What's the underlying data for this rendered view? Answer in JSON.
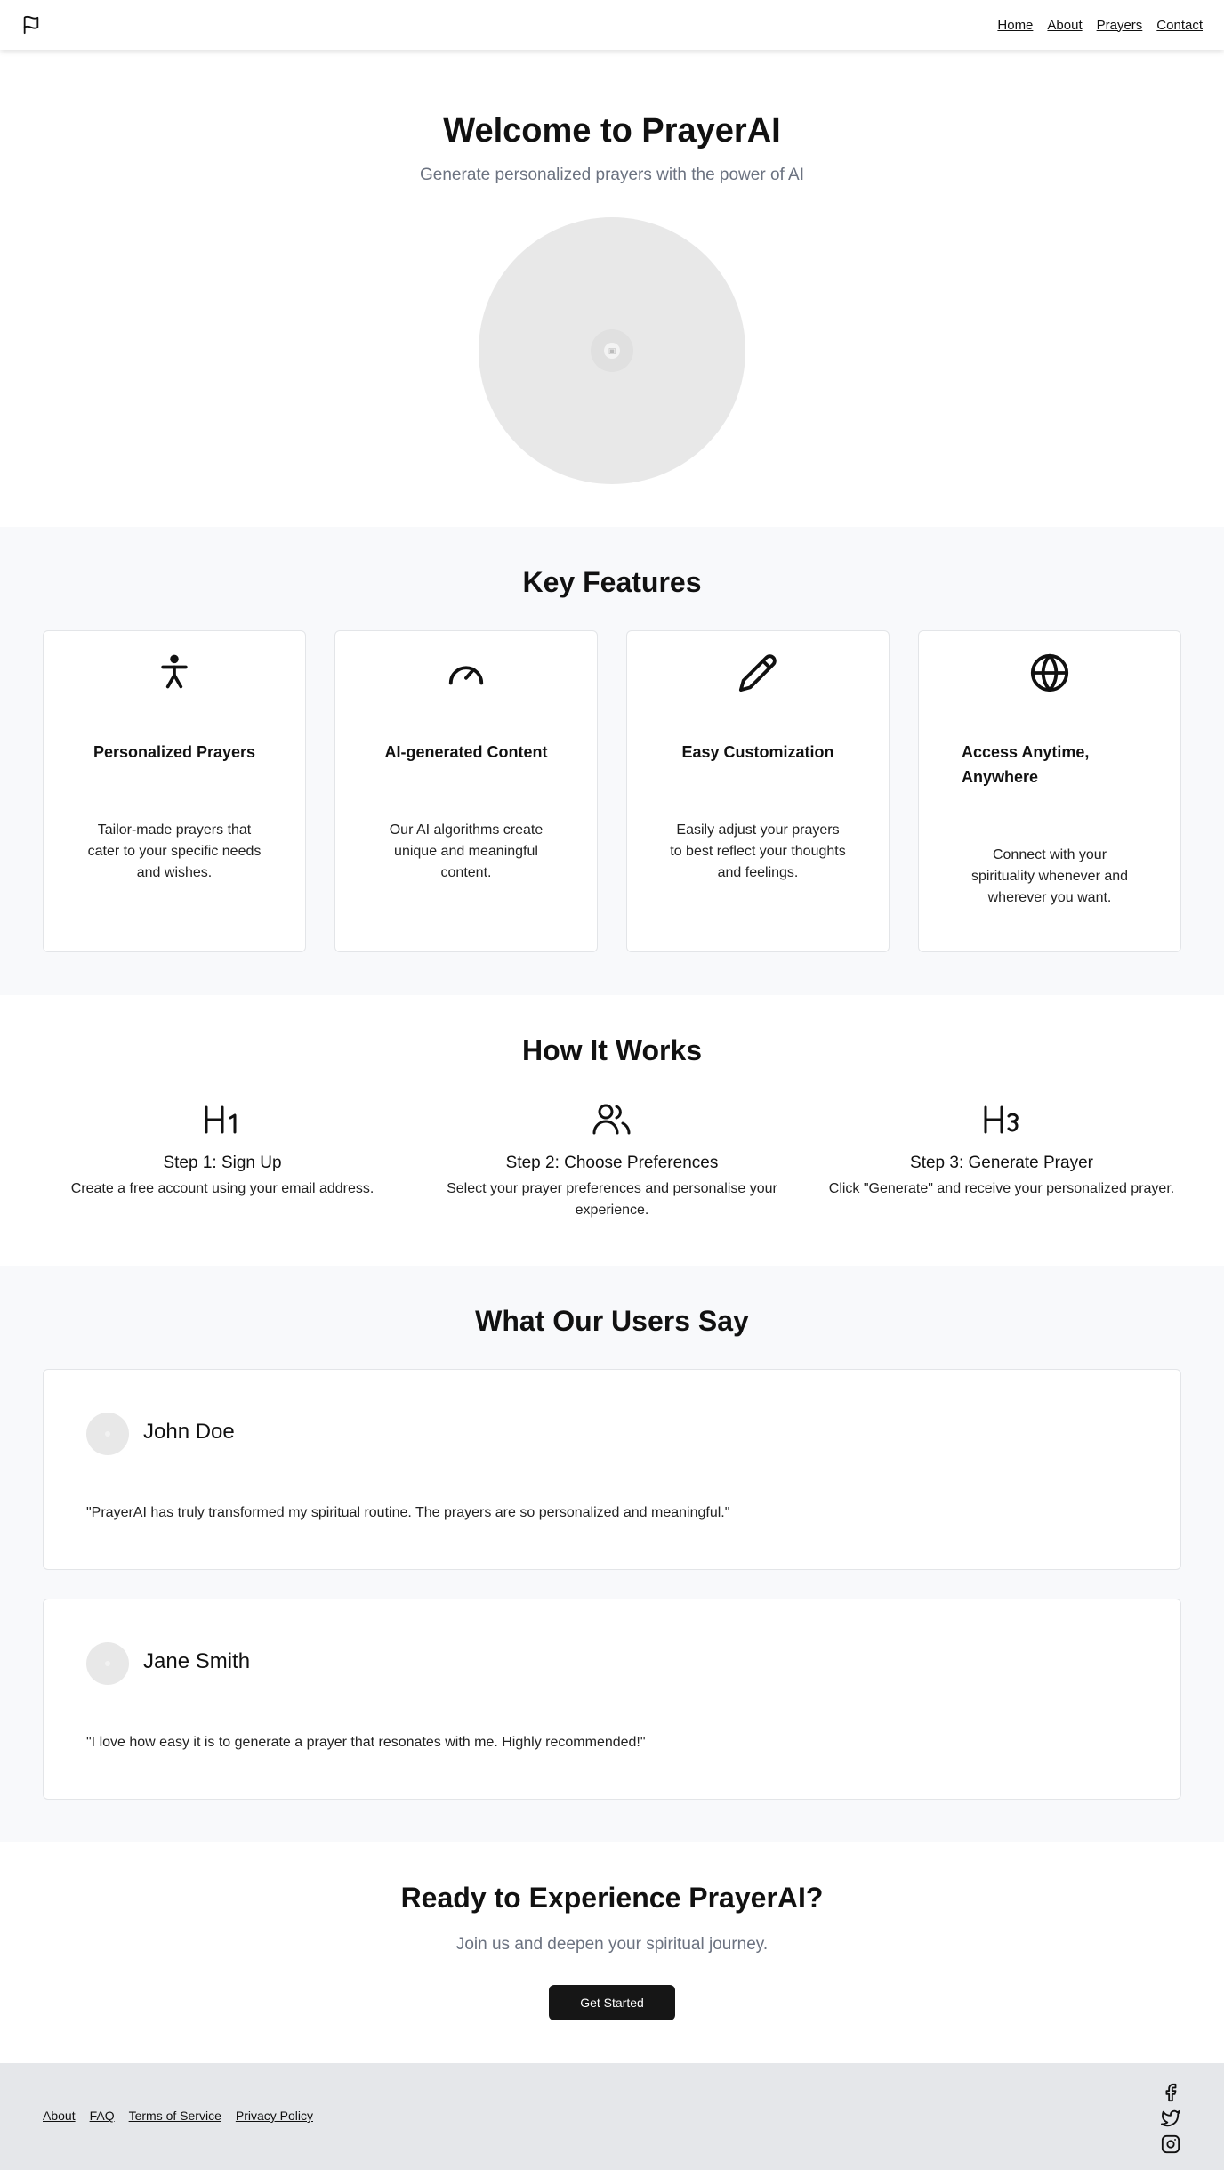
{
  "nav": {
    "logo_icon": "flag-icon",
    "items": [
      "Home",
      "About",
      "Prayers",
      "Contact"
    ]
  },
  "hero": {
    "title": "Welcome to PrayerAI",
    "subtitle": "Generate personalized prayers with the power of AI"
  },
  "features": {
    "heading": "Key Features",
    "cards": [
      {
        "icon": "person-icon",
        "title": "Personalized Prayers",
        "desc": "Tailor-made prayers that cater to your specific needs and wishes."
      },
      {
        "icon": "gauge-icon",
        "title": "AI-generated Content",
        "desc": "Our AI algorithms create unique and meaningful content."
      },
      {
        "icon": "pencil-icon",
        "title": "Easy Customization",
        "desc": "Easily adjust your prayers to best reflect your thoughts and feelings."
      },
      {
        "icon": "globe-icon",
        "title": "Access Anytime, Anywhere",
        "desc": "Connect with your spirituality whenever and wherever you want."
      }
    ]
  },
  "how": {
    "heading": "How It Works",
    "steps": [
      {
        "icon": "heading-1-icon",
        "title": "Step 1: Sign Up",
        "desc": "Create a free account using your email address."
      },
      {
        "icon": "users-icon",
        "title": "Step 2: Choose Preferences",
        "desc": "Select your prayer preferences and personalise your experience."
      },
      {
        "icon": "heading-3-icon",
        "title": "Step 3: Generate Prayer",
        "desc": "Click \"Generate\" and receive your personalized prayer."
      }
    ]
  },
  "testimonials": {
    "heading": "What Our Users Say",
    "items": [
      {
        "name": "John Doe",
        "quote": "\"PrayerAI has truly transformed my spiritual routine. The prayers are so personalized and meaningful.\""
      },
      {
        "name": "Jane Smith",
        "quote": "\"I love how easy it is to generate a prayer that resonates with me. Highly recommended!\""
      }
    ]
  },
  "cta": {
    "title": "Ready to Experience PrayerAI?",
    "subtitle": "Join us and deepen your spiritual journey.",
    "button": "Get Started"
  },
  "footer": {
    "links": [
      "About",
      "FAQ",
      "Terms of Service",
      "Privacy Policy"
    ],
    "social_icons": [
      "facebook-icon",
      "twitter-icon",
      "instagram-icon"
    ]
  }
}
